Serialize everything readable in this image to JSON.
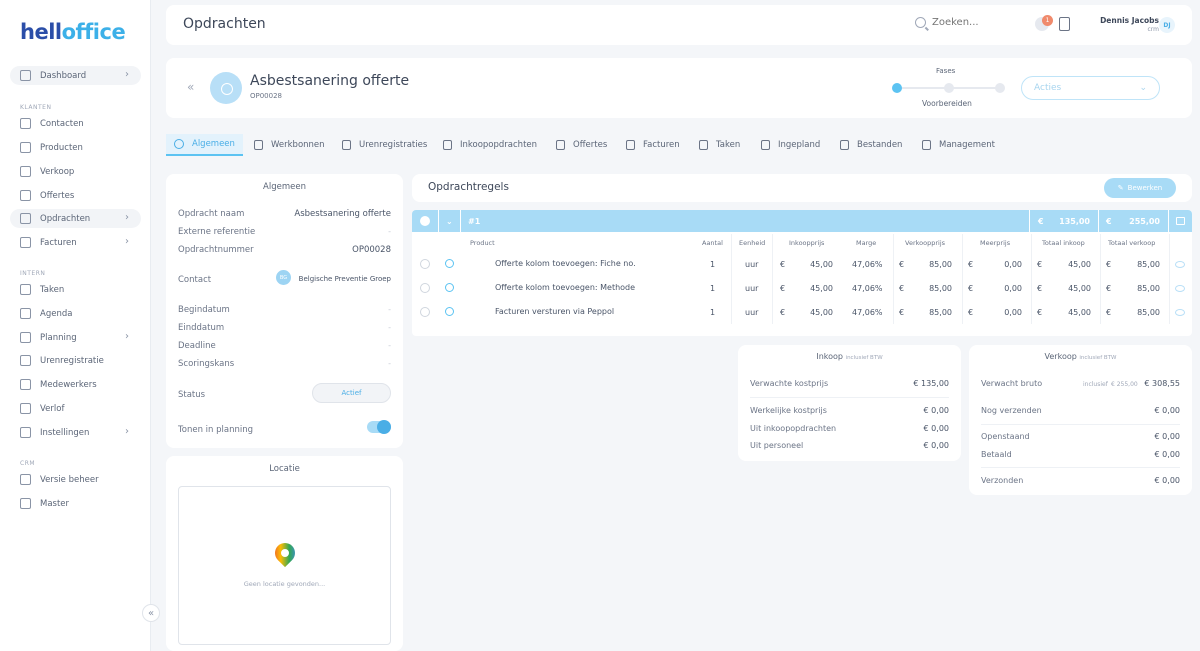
{
  "brand": {
    "part1": "hell",
    "part2": "office"
  },
  "sidebar": {
    "items": [
      {
        "label": "Dashboard"
      },
      {
        "label": "Contacten"
      },
      {
        "label": "Producten"
      },
      {
        "label": "Verkoop"
      },
      {
        "label": "Offertes"
      },
      {
        "label": "Opdrachten"
      },
      {
        "label": "Facturen"
      },
      {
        "label": "Taken"
      },
      {
        "label": "Agenda"
      },
      {
        "label": "Planning"
      },
      {
        "label": "Urenregistratie"
      },
      {
        "label": "Medewerkers"
      },
      {
        "label": "Verlof"
      },
      {
        "label": "Instellingen"
      },
      {
        "label": "Versie beheer"
      },
      {
        "label": "Master"
      }
    ],
    "sections": {
      "klanten": "Klanten",
      "intern": "Intern",
      "crm": "CRM"
    },
    "chev": "›",
    "collapse": "«"
  },
  "header": {
    "title": "Opdrachten",
    "search_placeholder": "Zoeken...",
    "notif_count": "1",
    "user_name": "Dennis Jacobs",
    "user_role": "crm",
    "user_initials": "DJ"
  },
  "job": {
    "back": "«",
    "title": "Asbestsanering offerte",
    "number": "OP00028",
    "fases_label": "Fases",
    "fase_current": "Voorbereiden",
    "acties": "Acties",
    "acties_chev": "⌄"
  },
  "tabs": [
    {
      "label": "Algemeen"
    },
    {
      "label": "Werkbonnen"
    },
    {
      "label": "Urenregistraties"
    },
    {
      "label": "Inkoopopdrachten"
    },
    {
      "label": "Offertes"
    },
    {
      "label": "Facturen"
    },
    {
      "label": "Taken"
    },
    {
      "label": "Ingepland"
    },
    {
      "label": "Bestanden"
    },
    {
      "label": "Management"
    }
  ],
  "general": {
    "title": "Algemeen",
    "fields": {
      "naam_label": "Opdracht naam",
      "naam_value": "Asbestsanering offerte",
      "ref_label": "Externe referentie",
      "ref_value": "-",
      "nummer_label": "Opdrachtnummer",
      "nummer_value": "OP00028",
      "contact_label": "Contact",
      "contact_initials": "BG",
      "contact_value": "Belgische Preventie Groep",
      "begin_label": "Begindatum",
      "begin_value": "-",
      "eind_label": "Einddatum",
      "eind_value": "-",
      "deadline_label": "Deadline",
      "deadline_value": "-",
      "kans_label": "Scoringskans",
      "kans_value": "-",
      "status_label": "Status",
      "status_value": "Actief",
      "planning_label": "Tonen in planning"
    }
  },
  "location": {
    "title": "Locatie",
    "empty": "Geen locatie gevonden..."
  },
  "lines": {
    "title": "Opdrachtregels",
    "edit_label": "Bewerken",
    "head_num": "#1",
    "head_chev": "⌄",
    "total_cost": "135,00",
    "total_sale": "255,00",
    "euro": "€",
    "columns": [
      "Product",
      "Aantal",
      "Eenheid",
      "Inkoopprijs",
      "Marge",
      "Verkoopprijs",
      "Meerprijs",
      "Totaal inkoop",
      "Totaal verkoop"
    ],
    "rows": [
      {
        "product": "Offerte kolom toevoegen: Fiche no.",
        "qty": "1",
        "unit": "uur",
        "cost": "45,00",
        "margin": "47,06%",
        "price": "85,00",
        "extra": "0,00",
        "tcost": "45,00",
        "tprice": "85,00"
      },
      {
        "product": "Offerte kolom toevoegen: Methode",
        "qty": "1",
        "unit": "uur",
        "cost": "45,00",
        "margin": "47,06%",
        "price": "85,00",
        "extra": "0,00",
        "tcost": "45,00",
        "tprice": "85,00"
      },
      {
        "product": "Facturen versturen via Peppol",
        "qty": "1",
        "unit": "uur",
        "cost": "45,00",
        "margin": "47,06%",
        "price": "85,00",
        "extra": "0,00",
        "tcost": "45,00",
        "tprice": "85,00"
      }
    ]
  },
  "inkoop": {
    "title": "Inkoop",
    "sub": "inclusief BTW",
    "verwacht_label": "Verwachte kostprijs",
    "verwacht_value": "€ 135,00",
    "werkelijk_label": "Werkelijke kostprijs",
    "werkelijk_value": "€ 0,00",
    "uit_inkoop_label": "Uit inkoopopdrachten",
    "uit_inkoop_value": "€ 0,00",
    "uit_pers_label": "Uit personeel",
    "uit_pers_value": "€ 0,00"
  },
  "verkoop": {
    "title": "Verkoop",
    "sub": "inclusief BTW",
    "bruto_label": "Verwacht bruto",
    "bruto_hint": "inclusief",
    "bruto_strike": "€ 255,00",
    "bruto_value": "€ 308,55",
    "nog_label": "Nog verzenden",
    "nog_value": "€ 0,00",
    "open_label": "Openstaand",
    "open_value": "€ 0,00",
    "betaald_label": "Betaald",
    "betaald_value": "€ 0,00",
    "verzonden_label": "Verzonden",
    "verzonden_value": "€ 0,00"
  },
  "colors": {
    "accent": "#5cc3f2",
    "brand_dark": "#2b4ea8",
    "badge": "#f08a6c"
  }
}
